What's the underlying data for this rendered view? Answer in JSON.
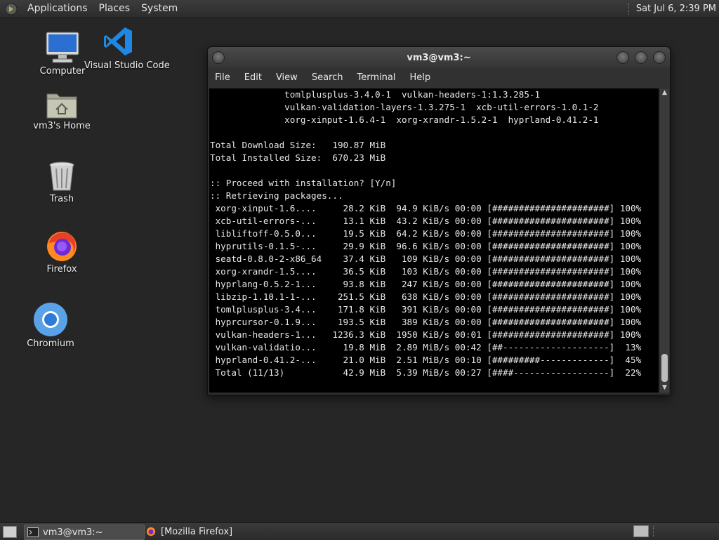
{
  "top_panel": {
    "menus": [
      "Applications",
      "Places",
      "System"
    ],
    "clock": "Sat Jul  6,  2:39 PM"
  },
  "desktop": {
    "icons": [
      {
        "label": "Computer",
        "icon": "computer-icon"
      },
      {
        "label": "Visual Studio Code",
        "icon": "vscode-icon"
      },
      {
        "label": "vm3's Home",
        "icon": "home-folder-icon"
      },
      {
        "label": "Trash",
        "icon": "trash-icon"
      },
      {
        "label": "Firefox",
        "icon": "firefox-icon"
      },
      {
        "label": "Chromium",
        "icon": "chromium-icon"
      }
    ]
  },
  "terminal": {
    "title": "vm3@vm3:~",
    "menus": [
      "File",
      "Edit",
      "View",
      "Search",
      "Terminal",
      "Help"
    ],
    "lines": [
      "              tomlplusplus-3.4.0-1  vulkan-headers-1:1.3.285-1",
      "              vulkan-validation-layers-1.3.275-1  xcb-util-errors-1.0.1-2",
      "              xorg-xinput-1.6.4-1  xorg-xrandr-1.5.2-1  hyprland-0.41.2-1",
      "",
      "Total Download Size:   190.87 MiB",
      "Total Installed Size:  670.23 MiB",
      "",
      ":: Proceed with installation? [Y/n]",
      ":: Retrieving packages...",
      " xorg-xinput-1.6....     28.2 KiB  94.9 KiB/s 00:00 [######################] 100%",
      " xcb-util-errors-...     13.1 KiB  43.2 KiB/s 00:00 [######################] 100%",
      " libliftoff-0.5.0...     19.5 KiB  64.2 KiB/s 00:00 [######################] 100%",
      " hyprutils-0.1.5-...     29.9 KiB  96.6 KiB/s 00:00 [######################] 100%",
      " seatd-0.8.0-2-x86_64    37.4 KiB   109 KiB/s 00:00 [######################] 100%",
      " xorg-xrandr-1.5....     36.5 KiB   103 KiB/s 00:00 [######################] 100%",
      " hyprlang-0.5.2-1...     93.8 KiB   247 KiB/s 00:00 [######################] 100%",
      " libzip-1.10.1-1-...    251.5 KiB   638 KiB/s 00:00 [######################] 100%",
      " tomlplusplus-3.4...    171.8 KiB   391 KiB/s 00:00 [######################] 100%",
      " hyprcursor-0.1.9...    193.5 KiB   389 KiB/s 00:00 [######################] 100%",
      " vulkan-headers-1...   1236.3 KiB  1950 KiB/s 00:01 [######################] 100%",
      " vulkan-validatio...     19.8 MiB  2.89 MiB/s 00:42 [##--------------------]  13%",
      " hyprland-0.41.2-...     21.0 MiB  2.51 MiB/s 00:10 [#########-------------]  45%",
      " Total (11/13)           42.9 MiB  5.39 MiB/s 00:27 [####------------------]  22%"
    ]
  },
  "taskbar": {
    "tasks": [
      {
        "label": "vm3@vm3:~",
        "icon": "terminal-icon",
        "active": true
      },
      {
        "label": "[Mozilla Firefox]",
        "icon": "firefox-icon",
        "active": false
      }
    ]
  }
}
